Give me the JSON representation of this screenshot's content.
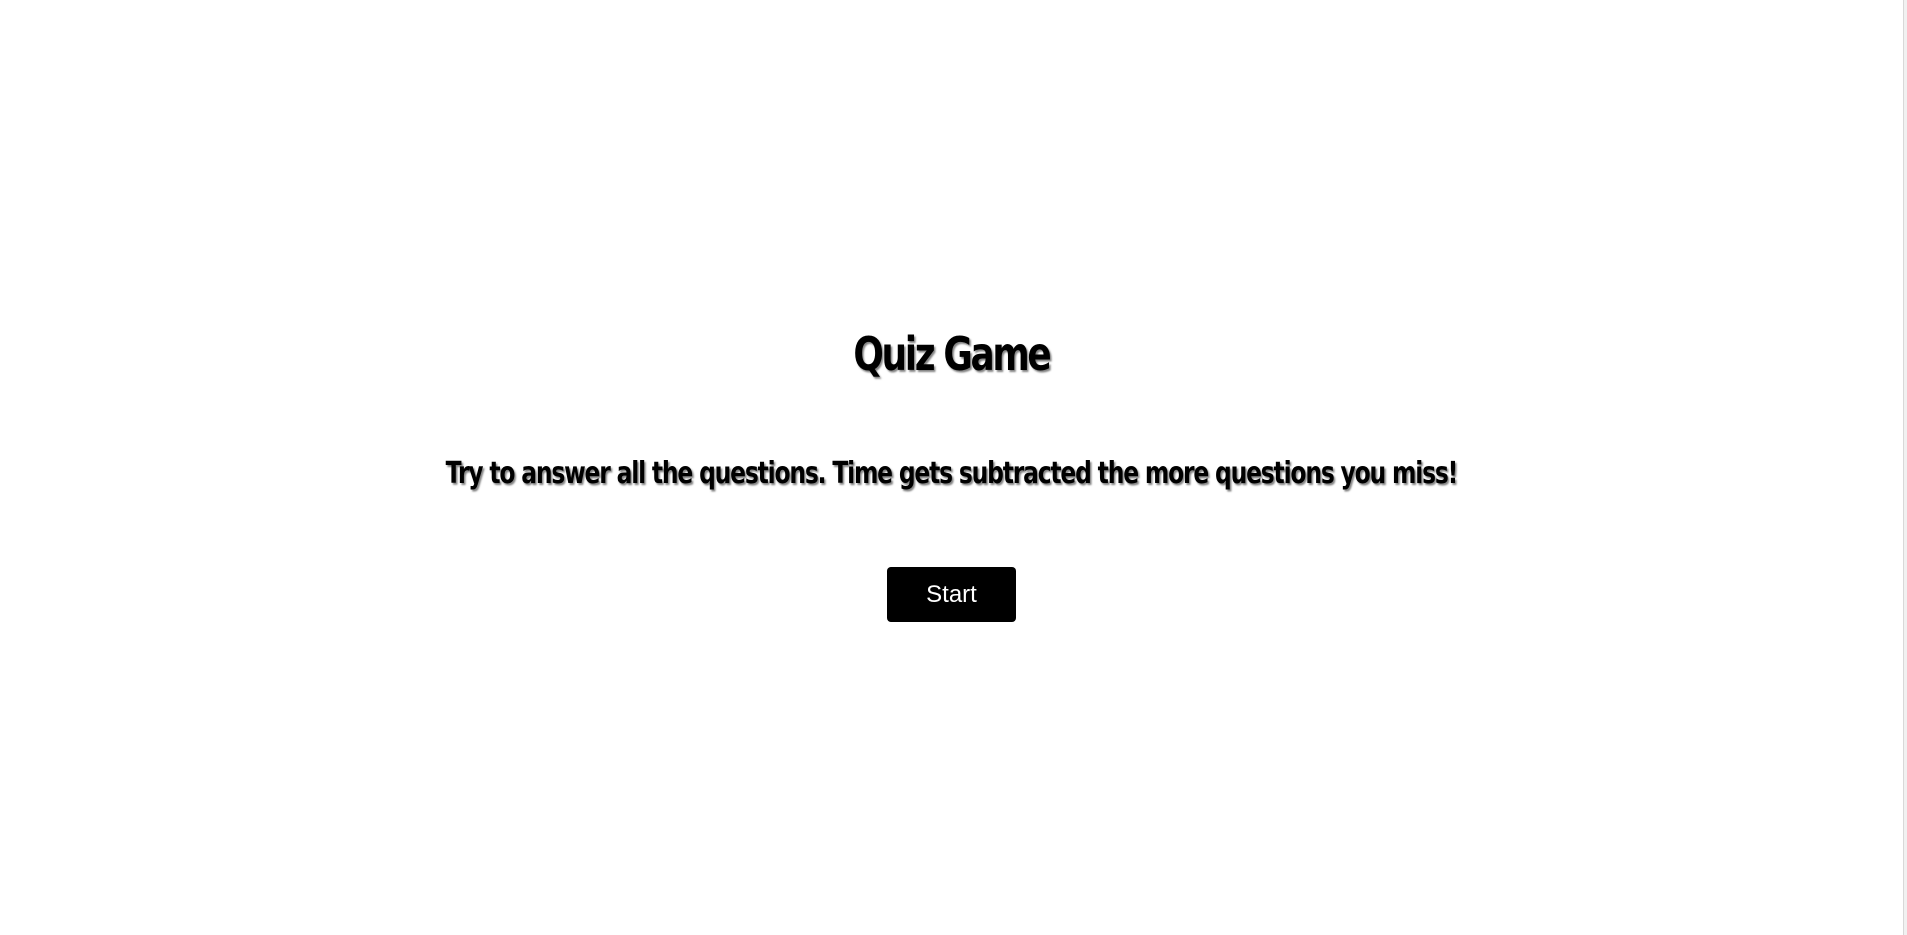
{
  "quiz": {
    "title": "Quiz Game",
    "instructions": "Try to answer all the questions. Time gets subtracted the more questions you miss!",
    "start_label": "Start"
  },
  "colors": {
    "background": "#ffffff",
    "text": "#000000",
    "button_background": "#000000",
    "button_text": "#ffffff"
  }
}
